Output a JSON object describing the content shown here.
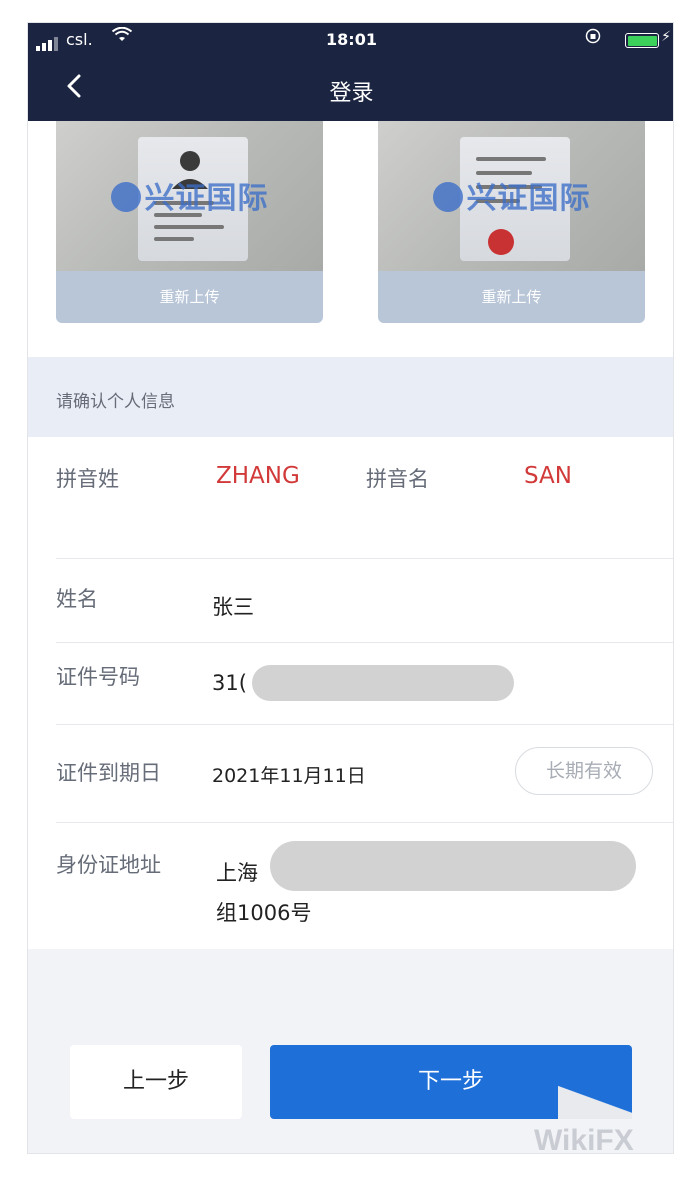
{
  "status_bar": {
    "carrier": "csl.",
    "time": "18:01"
  },
  "nav": {
    "title": "登录"
  },
  "upload": {
    "cards": [
      {
        "watermark": "兴证国际",
        "reupload_label": "重新上传"
      },
      {
        "watermark": "兴证国际",
        "reupload_label": "重新上传"
      }
    ]
  },
  "info_header": "请确认个人信息",
  "form": {
    "pinyin_surname_label": "拼音姓",
    "pinyin_surname_value": "ZHANG",
    "pinyin_given_label": "拼音名",
    "pinyin_given_value": "SAN",
    "name_label": "姓名",
    "name_value": "张三",
    "id_number_label": "证件号码",
    "id_number_value": "31(",
    "expiry_label": "证件到期日",
    "expiry_value": "2021年11月11日",
    "long_term_label": "长期有效",
    "address_label": "身份证地址",
    "address_line1": "上海",
    "address_line2": "组1006号"
  },
  "buttons": {
    "prev": "上一步",
    "next": "下一步"
  },
  "corner_watermark": "WikiFX",
  "colors": {
    "nav_bg": "#1b2440",
    "accent_blue": "#1f6fd8",
    "highlight_red": "#d23a3a",
    "reupload_bg": "#b9c6d8"
  }
}
